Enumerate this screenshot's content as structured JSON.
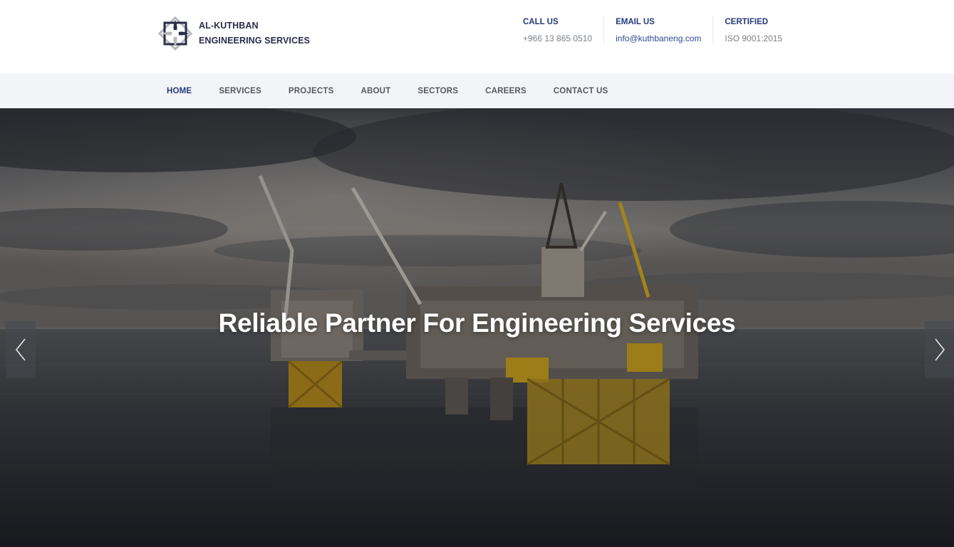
{
  "brand": {
    "line1": "AL-KUTHBAN",
    "line2": "ENGINEERING SERVICES",
    "colors": {
      "primary": "#233a78",
      "dark": "#2b2d4a",
      "accent": "#b8b9bf"
    }
  },
  "contacts": [
    {
      "title": "CALL US",
      "value": "+966 13 865 0510"
    },
    {
      "title": "EMAIL US",
      "value": "info@kuthbaneng.com"
    },
    {
      "title": "CERTIFIED",
      "value": "ISO 9001:2015"
    }
  ],
  "nav": {
    "items": [
      {
        "label": "HOME",
        "active": true
      },
      {
        "label": "SERVICES"
      },
      {
        "label": "PROJECTS"
      },
      {
        "label": "ABOUT"
      },
      {
        "label": "SECTORS"
      },
      {
        "label": "CAREERS"
      },
      {
        "label": "CONTACT US"
      }
    ]
  },
  "hero": {
    "title": "Reliable Partner For Engineering Services",
    "prev_icon": "chevron-left-icon",
    "next_icon": "chevron-right-icon"
  }
}
